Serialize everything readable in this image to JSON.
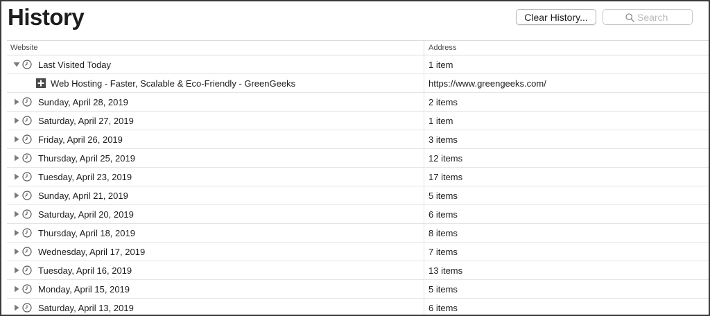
{
  "page": {
    "title": "History"
  },
  "toolbar": {
    "clear_label": "Clear History...",
    "search_placeholder": "Search",
    "search_value": ""
  },
  "columns": {
    "website": "Website",
    "address": "Address"
  },
  "rows": [
    {
      "type": "group",
      "label": "Last Visited Today",
      "address": "1 item",
      "expanded": true
    },
    {
      "type": "site",
      "label": "Web Hosting - Faster, Scalable & Eco-Friendly - GreenGeeks",
      "address": "https://www.greengeeks.com/"
    },
    {
      "type": "group",
      "label": "Sunday, April 28, 2019",
      "address": "2 items",
      "expanded": false
    },
    {
      "type": "group",
      "label": "Saturday, April 27, 2019",
      "address": "1 item",
      "expanded": false
    },
    {
      "type": "group",
      "label": "Friday, April 26, 2019",
      "address": "3 items",
      "expanded": false
    },
    {
      "type": "group",
      "label": "Thursday, April 25, 2019",
      "address": "12 items",
      "expanded": false
    },
    {
      "type": "group",
      "label": "Tuesday, April 23, 2019",
      "address": "17 items",
      "expanded": false
    },
    {
      "type": "group",
      "label": "Sunday, April 21, 2019",
      "address": "5 items",
      "expanded": false
    },
    {
      "type": "group",
      "label": "Saturday, April 20, 2019",
      "address": "6 items",
      "expanded": false
    },
    {
      "type": "group",
      "label": "Thursday, April 18, 2019",
      "address": "8 items",
      "expanded": false
    },
    {
      "type": "group",
      "label": "Wednesday, April 17, 2019",
      "address": "7 items",
      "expanded": false
    },
    {
      "type": "group",
      "label": "Tuesday, April 16, 2019",
      "address": "13 items",
      "expanded": false
    },
    {
      "type": "group",
      "label": "Monday, April 15, 2019",
      "address": "5 items",
      "expanded": false
    },
    {
      "type": "group",
      "label": "Saturday, April 13, 2019",
      "address": "6 items",
      "expanded": false
    }
  ],
  "icons": {
    "disclosure": "disclosure-triangle-icon",
    "clock": "clock-icon",
    "site": "favicon-icon",
    "search": "search-icon"
  },
  "colors": {
    "site_favicon": "#4a4a4a",
    "disclosure": "#7a7a7a"
  }
}
